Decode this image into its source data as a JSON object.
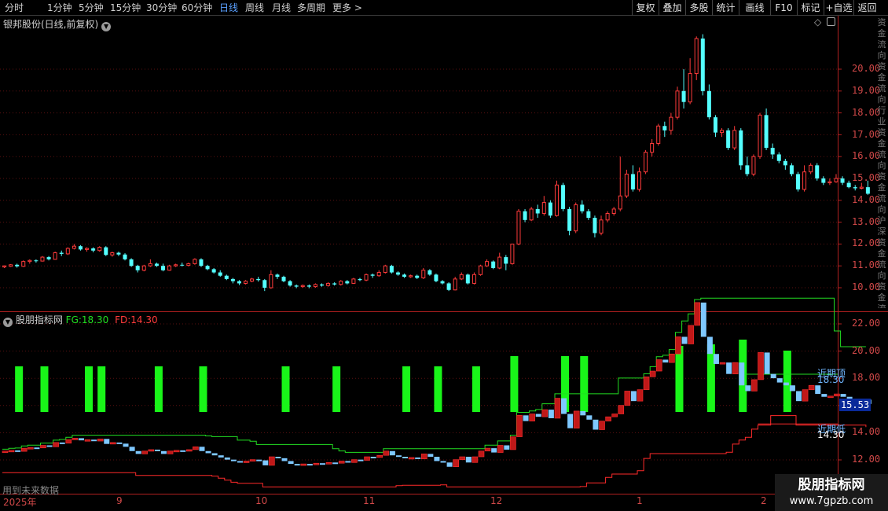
{
  "toolbar": {
    "periods": [
      "分时",
      "1分钟",
      "5分钟",
      "15分钟",
      "30分钟",
      "60分钟",
      "日线",
      "周线",
      "月线",
      "多周期",
      "更多 >"
    ],
    "active_period": "日线",
    "tools": [
      "复权",
      "叠加",
      "多股",
      "统计",
      "画线",
      "F10",
      "标记",
      "+自选",
      "返回"
    ]
  },
  "main_panel": {
    "title": "银邦股份(日线,前复权)",
    "settings_icon": "chevron-down-icon",
    "price_axis_labels": [
      "20.00",
      "19.00",
      "18.00",
      "17.00",
      "16.00",
      "15.00",
      "14.00",
      "13.00",
      "12.00",
      "11.00",
      "10.00"
    ]
  },
  "sidebar_strip": {
    "chars": "资金流向资金流向行业资金流向资金流向沪深资金流向资金流向收"
  },
  "indicator_panel": {
    "name": "股朋指标网",
    "fg_label": "FG:",
    "fg_value": "18.30",
    "fd_label": "FD:",
    "fd_value": "14.30",
    "axis_labels": [
      "22.00",
      "20.00",
      "18.00",
      "16.00",
      "14.00",
      "12.00"
    ],
    "current_value": "15.53",
    "annot_fg_name": "近期顶",
    "annot_fg_value": "18.30",
    "annot_fd_name": "近期低",
    "annot_fd_value": "14.30",
    "bottom_text": "用到未来数据"
  },
  "time_axis": {
    "labels": [
      "2025年",
      "9",
      "10",
      "11",
      "12",
      "1",
      "2"
    ]
  },
  "watermark": {
    "title": "股朋指标网",
    "url": "www.7gpzb.com"
  },
  "colors": {
    "up": "#ff3b3b",
    "down": "#54ffff",
    "fg_line": "#22dd22",
    "fd_line": "#ff2a2a",
    "signal_bar": "#19f519",
    "axis": "#b02020"
  },
  "chart_data": {
    "type": "candlestick",
    "title": "银邦股份(日线,前复权)",
    "period": "daily",
    "y_axis_ticks": [
      10,
      11,
      12,
      13,
      14,
      15,
      16,
      17,
      18,
      19,
      20
    ],
    "x_month_labels": [
      "2025年",
      "9",
      "10",
      "11",
      "12",
      "1",
      "2"
    ],
    "candles": [
      [
        10.95,
        11.0,
        10.9,
        11.02
      ],
      [
        10.98,
        11.05,
        10.95,
        11.08
      ],
      [
        11.05,
        10.98,
        10.92,
        11.1
      ],
      [
        10.98,
        11.2,
        10.95,
        11.25
      ],
      [
        11.2,
        11.25,
        11.1,
        11.3
      ],
      [
        11.25,
        11.22,
        11.15,
        11.3
      ],
      [
        11.22,
        11.4,
        11.2,
        11.45
      ],
      [
        11.4,
        11.3,
        11.25,
        11.45
      ],
      [
        11.3,
        11.6,
        11.28,
        11.65
      ],
      [
        11.6,
        11.55,
        11.45,
        11.7
      ],
      [
        11.55,
        11.8,
        11.5,
        11.85
      ],
      [
        11.8,
        11.9,
        11.75,
        12.0
      ],
      [
        11.9,
        11.75,
        11.7,
        11.95
      ],
      [
        11.75,
        11.8,
        11.65,
        11.85
      ],
      [
        11.8,
        11.7,
        11.62,
        11.85
      ],
      [
        11.7,
        11.85,
        11.65,
        11.9
      ],
      [
        11.85,
        11.5,
        11.45,
        11.9
      ],
      [
        11.5,
        11.6,
        11.42,
        11.65
      ],
      [
        11.6,
        11.52,
        11.45,
        11.65
      ],
      [
        11.52,
        11.3,
        11.25,
        11.58
      ],
      [
        11.3,
        11.0,
        10.95,
        11.35
      ],
      [
        11.0,
        10.8,
        10.7,
        11.05
      ],
      [
        10.8,
        11.0,
        10.75,
        11.05
      ],
      [
        11.0,
        11.1,
        10.95,
        11.3
      ],
      [
        11.1,
        11.0,
        10.95,
        11.15
      ],
      [
        11.0,
        10.8,
        10.75,
        11.1
      ],
      [
        10.8,
        11.0,
        10.78,
        11.05
      ],
      [
        11.0,
        11.05,
        10.95,
        11.1
      ],
      [
        11.05,
        11.02,
        10.98,
        11.15
      ],
      [
        11.02,
        11.1,
        10.98,
        11.15
      ],
      [
        11.1,
        11.3,
        11.05,
        11.35
      ],
      [
        11.3,
        11.0,
        10.95,
        11.35
      ],
      [
        11.0,
        10.85,
        10.8,
        11.05
      ],
      [
        10.85,
        10.7,
        10.65,
        10.9
      ],
      [
        10.7,
        10.55,
        10.5,
        10.8
      ],
      [
        10.55,
        10.4,
        10.35,
        10.6
      ],
      [
        10.4,
        10.3,
        10.2,
        10.45
      ],
      [
        10.3,
        10.2,
        10.12,
        10.35
      ],
      [
        10.2,
        10.3,
        10.15,
        10.35
      ],
      [
        10.3,
        10.4,
        10.25,
        10.45
      ],
      [
        10.4,
        10.35,
        10.28,
        10.5
      ],
      [
        10.35,
        10.0,
        9.85,
        10.4
      ],
      [
        10.0,
        10.6,
        9.95,
        10.8
      ],
      [
        10.6,
        10.5,
        10.4,
        10.65
      ],
      [
        10.5,
        10.3,
        10.25,
        10.55
      ],
      [
        10.3,
        10.1,
        10.05,
        10.35
      ],
      [
        10.1,
        10.05,
        9.98,
        10.15
      ],
      [
        10.05,
        10.1,
        10.0,
        10.15
      ],
      [
        10.1,
        10.05,
        9.98,
        10.15
      ],
      [
        10.05,
        10.15,
        10.0,
        10.2
      ],
      [
        10.15,
        10.1,
        10.05,
        10.2
      ],
      [
        10.1,
        10.2,
        10.05,
        10.25
      ],
      [
        10.2,
        10.15,
        10.1,
        10.25
      ],
      [
        10.15,
        10.3,
        10.1,
        10.35
      ],
      [
        10.3,
        10.2,
        10.15,
        10.35
      ],
      [
        10.2,
        10.4,
        10.18,
        10.45
      ],
      [
        10.4,
        10.35,
        10.3,
        10.45
      ],
      [
        10.35,
        10.6,
        10.3,
        10.65
      ],
      [
        10.6,
        10.55,
        10.45,
        10.65
      ],
      [
        10.55,
        10.7,
        10.5,
        10.8
      ],
      [
        10.7,
        11.0,
        10.65,
        11.05
      ],
      [
        11.0,
        10.7,
        10.65,
        11.05
      ],
      [
        10.7,
        10.6,
        10.55,
        10.75
      ],
      [
        10.6,
        10.5,
        10.45,
        10.65
      ],
      [
        10.5,
        10.55,
        10.45,
        10.6
      ],
      [
        10.55,
        10.45,
        10.4,
        10.6
      ],
      [
        10.45,
        10.8,
        10.4,
        10.9
      ],
      [
        10.8,
        10.6,
        10.55,
        10.85
      ],
      [
        10.6,
        10.3,
        10.25,
        10.65
      ],
      [
        10.3,
        10.2,
        10.15,
        10.35
      ],
      [
        10.2,
        9.9,
        9.85,
        10.25
      ],
      [
        9.9,
        10.4,
        9.88,
        10.5
      ],
      [
        10.4,
        10.6,
        10.35,
        10.7
      ],
      [
        10.6,
        10.2,
        10.15,
        10.65
      ],
      [
        10.2,
        10.6,
        10.15,
        10.7
      ],
      [
        10.6,
        11.0,
        10.55,
        11.05
      ],
      [
        11.0,
        11.2,
        10.95,
        11.3
      ],
      [
        11.2,
        10.9,
        10.85,
        11.25
      ],
      [
        10.9,
        11.4,
        10.85,
        11.6
      ],
      [
        11.4,
        11.1,
        10.8,
        11.5
      ],
      [
        11.1,
        12.0,
        11.05,
        12.0
      ],
      [
        12.0,
        13.5,
        11.95,
        13.6
      ],
      [
        13.5,
        13.1,
        13.0,
        13.6
      ],
      [
        13.1,
        13.6,
        13.05,
        13.7
      ],
      [
        13.6,
        13.4,
        13.2,
        13.8
      ],
      [
        13.4,
        13.9,
        13.3,
        14.2
      ],
      [
        13.9,
        13.3,
        13.2,
        14.0
      ],
      [
        13.3,
        14.7,
        13.25,
        14.9
      ],
      [
        14.7,
        13.6,
        13.5,
        14.8
      ],
      [
        13.6,
        12.6,
        12.4,
        13.7
      ],
      [
        12.6,
        13.8,
        12.5,
        13.9
      ],
      [
        13.8,
        13.5,
        13.4,
        14.0
      ],
      [
        13.5,
        13.2,
        13.1,
        13.6
      ],
      [
        13.2,
        12.5,
        12.3,
        13.3
      ],
      [
        12.5,
        13.1,
        12.4,
        13.3
      ],
      [
        13.1,
        13.4,
        13.0,
        13.5
      ],
      [
        13.4,
        13.6,
        13.3,
        13.7
      ],
      [
        13.6,
        14.2,
        13.5,
        16.0
      ],
      [
        14.2,
        15.2,
        14.1,
        15.4
      ],
      [
        15.2,
        14.5,
        14.4,
        15.6
      ],
      [
        14.5,
        15.3,
        14.4,
        15.5
      ],
      [
        15.3,
        16.2,
        15.2,
        16.3
      ],
      [
        16.2,
        16.6,
        16.0,
        16.8
      ],
      [
        16.6,
        17.4,
        16.5,
        17.5
      ],
      [
        17.4,
        17.2,
        16.9,
        17.6
      ],
      [
        17.2,
        17.8,
        17.0,
        18.0
      ],
      [
        17.8,
        19.0,
        17.7,
        19.2
      ],
      [
        19.0,
        18.5,
        18.2,
        20.0
      ],
      [
        18.5,
        19.8,
        18.4,
        20.5
      ],
      [
        19.8,
        21.4,
        19.5,
        21.5
      ],
      [
        21.4,
        19.0,
        18.8,
        21.6
      ],
      [
        19.0,
        17.8,
        17.7,
        19.3
      ],
      [
        17.8,
        17.1,
        16.9,
        17.9
      ],
      [
        17.1,
        17.2,
        16.9,
        17.3
      ],
      [
        17.2,
        16.4,
        16.3,
        17.3
      ],
      [
        16.4,
        17.2,
        16.3,
        17.4
      ],
      [
        17.2,
        15.6,
        15.4,
        17.3
      ],
      [
        15.6,
        15.2,
        15.1,
        16.0
      ],
      [
        15.2,
        16.0,
        15.1,
        16.1
      ],
      [
        16.0,
        17.9,
        15.9,
        18.0
      ],
      [
        17.9,
        16.4,
        16.3,
        18.2
      ],
      [
        16.4,
        16.1,
        15.9,
        16.6
      ],
      [
        16.1,
        15.8,
        15.7,
        16.2
      ],
      [
        15.8,
        15.6,
        15.4,
        15.9
      ],
      [
        15.6,
        15.2,
        15.1,
        15.7
      ],
      [
        15.2,
        14.5,
        14.4,
        15.3
      ],
      [
        14.5,
        15.3,
        14.4,
        15.6
      ],
      [
        15.3,
        15.6,
        15.2,
        15.7
      ],
      [
        15.6,
        15.0,
        14.9,
        15.7
      ],
      [
        15.0,
        14.8,
        14.7,
        15.1
      ],
      [
        14.8,
        14.85,
        14.7,
        15.0
      ],
      [
        14.85,
        15.0,
        14.8,
        15.2
      ],
      [
        15.0,
        14.8,
        14.7,
        15.1
      ],
      [
        14.8,
        14.6,
        14.55,
        14.9
      ],
      [
        14.6,
        14.55,
        14.45,
        14.7
      ],
      [
        14.55,
        14.6,
        14.5,
        14.8
      ],
      [
        14.6,
        14.3,
        14.25,
        14.9
      ]
    ],
    "signal_bars": [
      2,
      6,
      13,
      15,
      24,
      31,
      44,
      52,
      63,
      68,
      74,
      80,
      88,
      91,
      106,
      111,
      116,
      123
    ],
    "fg_level": 18.3,
    "fd_level": 14.3,
    "current_value": 15.53
  }
}
